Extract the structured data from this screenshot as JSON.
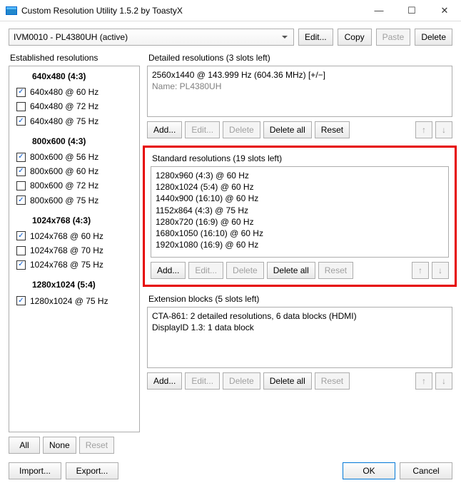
{
  "window": {
    "title": "Custom Resolution Utility 1.5.2 by ToastyX",
    "min": "—",
    "max": "☐",
    "close": "✕"
  },
  "display_dropdown": "IVM0010 - PL4380UH (active)",
  "top_buttons": {
    "edit": "Edit...",
    "copy": "Copy",
    "paste": "Paste",
    "delete": "Delete"
  },
  "left": {
    "label": "Established resolutions",
    "all": "All",
    "none": "None",
    "reset": "Reset",
    "groups": [
      {
        "head": "640x480 (4:3)",
        "items": [
          {
            "label": "640x480 @ 60 Hz",
            "checked": true
          },
          {
            "label": "640x480 @ 72 Hz",
            "checked": false
          },
          {
            "label": "640x480 @ 75 Hz",
            "checked": true
          }
        ]
      },
      {
        "head": "800x600 (4:3)",
        "items": [
          {
            "label": "800x600 @ 56 Hz",
            "checked": true
          },
          {
            "label": "800x600 @ 60 Hz",
            "checked": true
          },
          {
            "label": "800x600 @ 72 Hz",
            "checked": false
          },
          {
            "label": "800x600 @ 75 Hz",
            "checked": true
          }
        ]
      },
      {
        "head": "1024x768 (4:3)",
        "items": [
          {
            "label": "1024x768 @ 60 Hz",
            "checked": true
          },
          {
            "label": "1024x768 @ 70 Hz",
            "checked": false
          },
          {
            "label": "1024x768 @ 75 Hz",
            "checked": true
          }
        ]
      },
      {
        "head": "1280x1024 (5:4)",
        "items": [
          {
            "label": "1280x1024 @ 75 Hz",
            "checked": true
          }
        ]
      }
    ]
  },
  "detailed": {
    "label": "Detailed resolutions (3 slots left)",
    "line1": "2560x1440 @ 143.999 Hz (604.36 MHz) [+/−]",
    "line2": "Name: PL4380UH",
    "buttons": {
      "add": "Add...",
      "edit": "Edit...",
      "delete": "Delete",
      "deleteall": "Delete all",
      "reset": "Reset",
      "up": "↑",
      "down": "↓"
    }
  },
  "standard": {
    "label": "Standard resolutions (19 slots left)",
    "items": [
      "1280x960 (4:3) @ 60 Hz",
      "1280x1024 (5:4) @ 60 Hz",
      "1440x900 (16:10) @ 60 Hz",
      "1152x864 (4:3) @ 75 Hz",
      "1280x720 (16:9) @ 60 Hz",
      "1680x1050 (16:10) @ 60 Hz",
      "1920x1080 (16:9) @ 60 Hz"
    ],
    "buttons": {
      "add": "Add...",
      "edit": "Edit...",
      "delete": "Delete",
      "deleteall": "Delete all",
      "reset": "Reset",
      "up": "↑",
      "down": "↓"
    }
  },
  "extension": {
    "label": "Extension blocks (5 slots left)",
    "items": [
      "CTA-861: 2 detailed resolutions, 6 data blocks (HDMI)",
      "DisplayID 1.3: 1 data block"
    ],
    "buttons": {
      "add": "Add...",
      "edit": "Edit...",
      "delete": "Delete",
      "deleteall": "Delete all",
      "reset": "Reset",
      "up": "↑",
      "down": "↓"
    }
  },
  "bottom": {
    "import": "Import...",
    "export": "Export...",
    "ok": "OK",
    "cancel": "Cancel"
  }
}
